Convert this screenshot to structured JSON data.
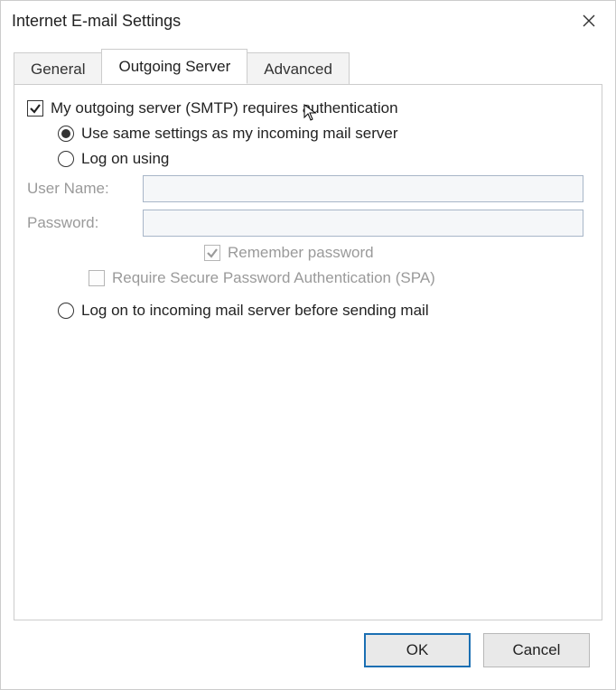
{
  "window": {
    "title": "Internet E-mail Settings"
  },
  "tabs": {
    "general": "General",
    "outgoing": "Outgoing Server",
    "advanced": "Advanced"
  },
  "panel": {
    "requires_auth_label": "My outgoing server (SMTP) requires authentication",
    "use_same_label": "Use same settings as my incoming mail server",
    "logon_using_label": "Log on using",
    "username_label": "User Name:",
    "password_label": "Password:",
    "remember_password_label": "Remember password",
    "require_spa_label": "Require Secure Password Authentication (SPA)",
    "logon_incoming_label": "Log on to incoming mail server before sending mail",
    "username_value": "",
    "password_value": ""
  },
  "buttons": {
    "ok": "OK",
    "cancel": "Cancel"
  }
}
